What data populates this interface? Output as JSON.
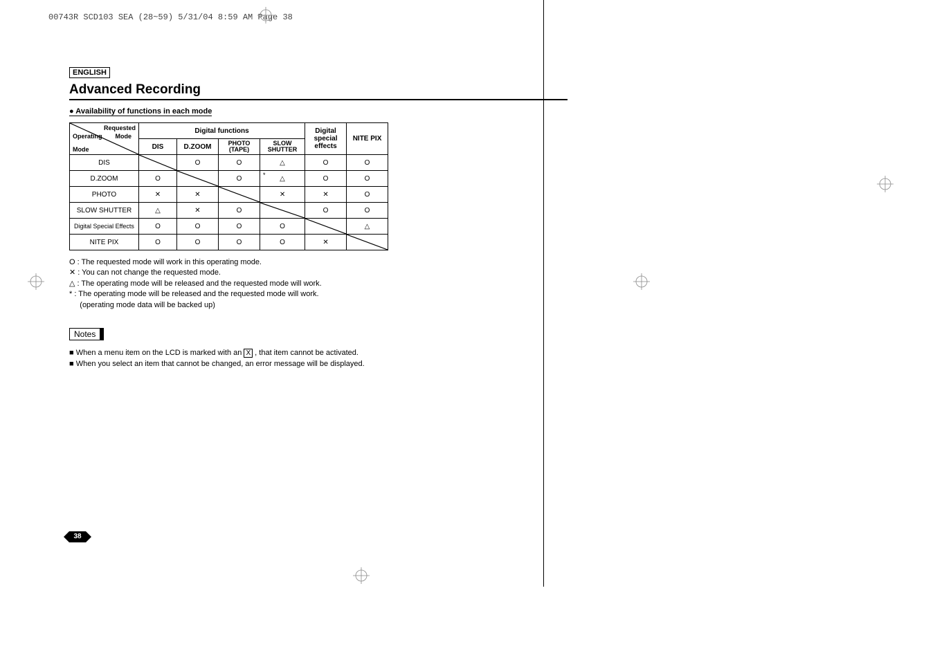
{
  "headerStrip": "00743R SCD103 SEA (28~59)  5/31/04 8:59 AM  Page 38",
  "english": "ENGLISH",
  "title": "Advanced Recording",
  "subtitle": "Availability of functions in each mode",
  "corner": {
    "requested": "Requested",
    "mode1": "Mode",
    "operating": "Operating",
    "mode2": "Mode"
  },
  "headers": {
    "digitalFunctions": "Digital functions",
    "dis": "DIS",
    "dzoom": "D.ZOOM",
    "photoTape1": "PHOTO",
    "photoTape2": "(TAPE)",
    "slowShutter1": "SLOW",
    "slowShutter2": "SHUTTER",
    "digitalSpecial1": "Digital",
    "digitalSpecial2": "special",
    "digitalSpecial3": "effects",
    "nitePix": "NITE PIX"
  },
  "rows": {
    "dis": "DIS",
    "dzoom": "D.ZOOM",
    "photo": "PHOTO",
    "slowShutter": "SLOW SHUTTER",
    "dse": "Digital Special Effects",
    "nitePix": "NITE PIX"
  },
  "symbols": {
    "O": "O",
    "X": "✕",
    "T": "△",
    "star": "*"
  },
  "legend": {
    "o": "O : The requested mode will work in this operating mode.",
    "x": "✕ : You can not change the requested mode.",
    "t": "△ : The operating mode will be released and the requested mode will work.",
    "star1": " *  : The operating mode will be released and the requested mode will work.",
    "star2": "     (operating mode data will be backed up)"
  },
  "notesLabel": "Notes",
  "notes": {
    "n1a": "When a menu item on the LCD is marked with an ",
    "n1x": "X",
    "n1b": " , that item cannot be activated.",
    "n2": "When you select an item that cannot be changed, an error message will be displayed."
  },
  "pageNum": "38"
}
